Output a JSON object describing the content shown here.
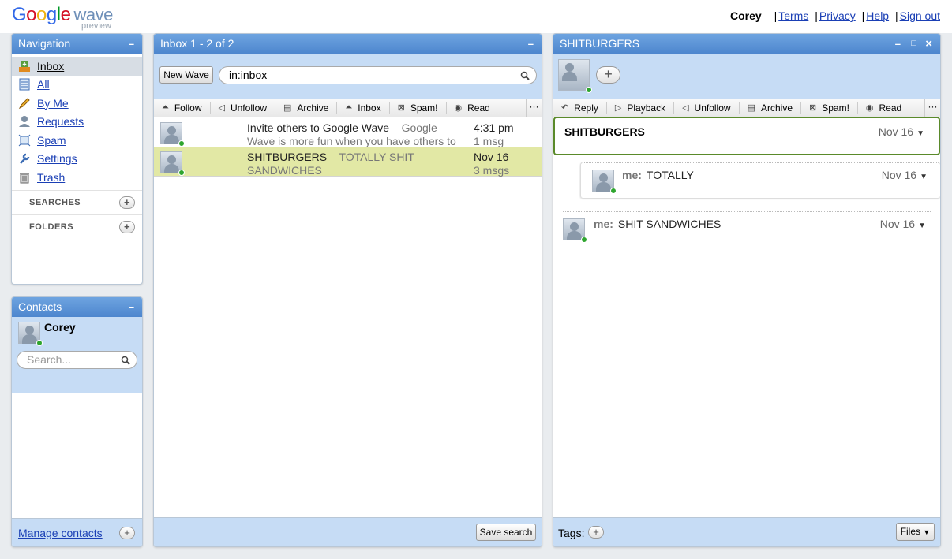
{
  "header": {
    "logo_letters": [
      "G",
      "o",
      "o",
      "g",
      "l",
      "e"
    ],
    "logo_product": "wave",
    "logo_sub": "preview",
    "user_name": "Corey",
    "links": [
      "Terms",
      "Privacy",
      "Help",
      "Sign out"
    ]
  },
  "navigation": {
    "title": "Navigation",
    "minimize": "–",
    "items": [
      {
        "label": "Inbox",
        "icon": "inbox-icon"
      },
      {
        "label": "All",
        "icon": "all-waves-icon"
      },
      {
        "label": "By Me",
        "icon": "pencil-icon"
      },
      {
        "label": "Requests",
        "icon": "requests-icon"
      },
      {
        "label": "Spam",
        "icon": "spam-icon"
      },
      {
        "label": "Settings",
        "icon": "wrench-icon"
      },
      {
        "label": "Trash",
        "icon": "trash-icon"
      }
    ],
    "sections": [
      "SEARCHES",
      "FOLDERS"
    ]
  },
  "contacts": {
    "title": "Contacts",
    "minimize": "–",
    "me_name": "Corey",
    "search_placeholder": "Search...",
    "manage_label": "Manage contacts"
  },
  "inbox": {
    "title": "Inbox 1 - 2 of 2",
    "minimize": "–",
    "new_wave_label": "New Wave",
    "search_value": "in:inbox",
    "toolbar": [
      "Follow",
      "Unfollow",
      "Archive",
      "Inbox",
      "Spam!",
      "Read"
    ],
    "more": "···",
    "waves": [
      {
        "subject": "Invite others to Google Wave",
        "snippet": " – Google Wave is more fun when you have others to wave",
        "time": "4:31 pm",
        "count": "1 msg"
      },
      {
        "subject": "SHITBURGERS",
        "snippet": " – TOTALLY SHIT SANDWICHES",
        "time": "Nov 16",
        "count": "3 msgs"
      }
    ],
    "save_search_label": "Save search"
  },
  "wave": {
    "title": "SHITBURGERS",
    "controls": [
      "–",
      "□",
      "×"
    ],
    "add_participant": "+",
    "toolbar": [
      "Reply",
      "Playback",
      "Unfollow",
      "Archive",
      "Spam!",
      "Read"
    ],
    "more": "···",
    "root_blip": {
      "text": "SHITBURGERS",
      "date": "Nov 16"
    },
    "reply_blip": {
      "author": "me:",
      "text": "TOTALLY",
      "date": "Nov 16"
    },
    "third_blip": {
      "author": "me:",
      "text": "SHIT SANDWICHES",
      "date": "Nov 16"
    },
    "tags_label": "Tags:",
    "files_label": "Files"
  },
  "colors": {
    "header_blue": "#4d86ce",
    "light_blue": "#c6dcf5",
    "selected_row": "#e2e8a5",
    "link": "#1a3fb5",
    "online": "#2ea52e",
    "blip_focus": "#5a8a2a"
  }
}
